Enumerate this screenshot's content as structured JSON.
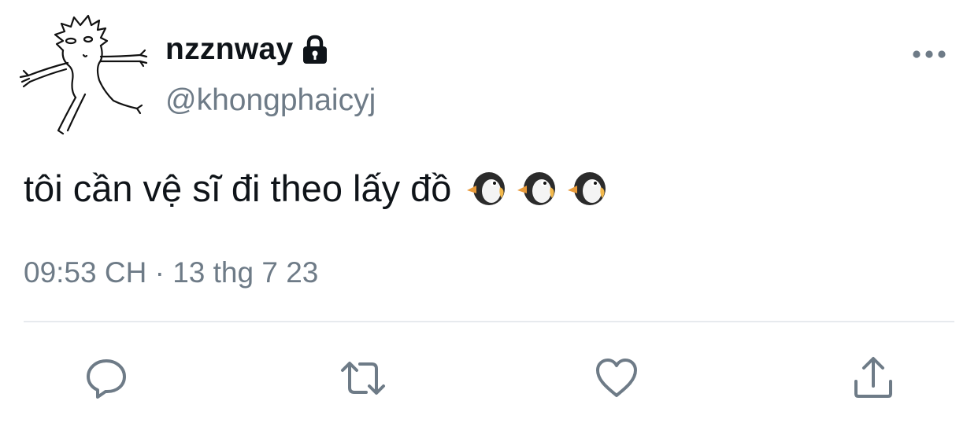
{
  "user": {
    "display_name": "nzznway",
    "handle": "@khongphaicyj",
    "protected_icon": "lock-icon",
    "avatar_icon": "stick-figure-drawing"
  },
  "tweet": {
    "text": "tôi cần vệ sĩ đi theo lấy đồ",
    "emojis": [
      "penguin-emoji",
      "penguin-emoji",
      "penguin-emoji"
    ],
    "timestamp": "09:53 CH · 13 thg 7 23"
  },
  "actions": [
    {
      "name": "reply",
      "icon": "speech-bubble-icon"
    },
    {
      "name": "retweet",
      "icon": "retweet-arrows-icon"
    },
    {
      "name": "like",
      "icon": "heart-icon"
    },
    {
      "name": "share",
      "icon": "share-arrow-icon"
    }
  ],
  "menu_icon": "more-dots-icon",
  "colors": {
    "text": "#0f1419",
    "secondary": "#6e7b87",
    "divider": "#e7eaee",
    "background": "#ffffff"
  }
}
